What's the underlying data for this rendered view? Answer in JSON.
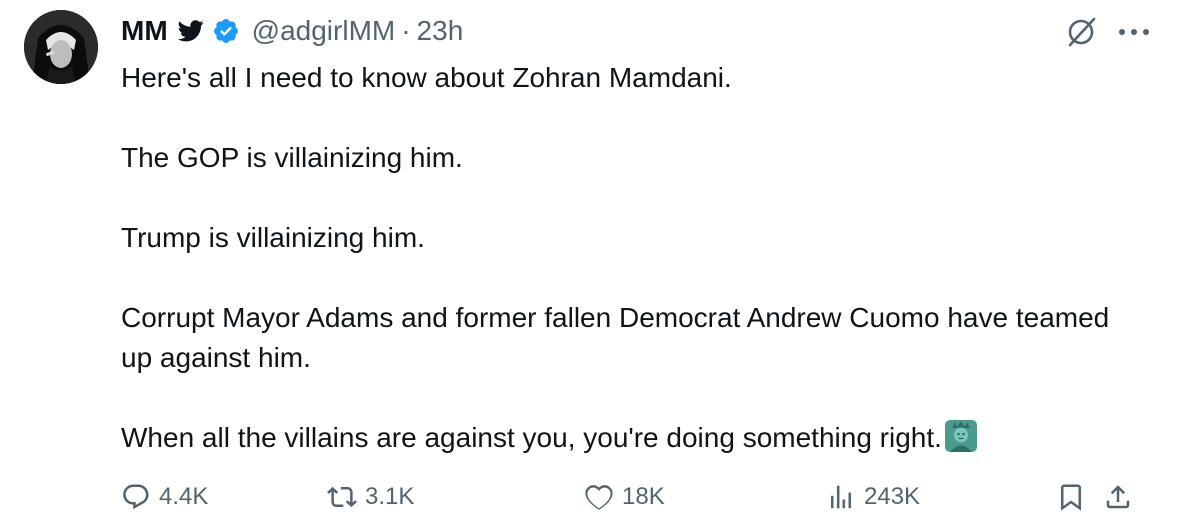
{
  "author": {
    "display_name": "MM",
    "handle": "@adgirlMM",
    "separator": "·",
    "time": "23h"
  },
  "tweet": {
    "paragraphs": [
      "Here's all I need to know about Zohran Mamdani.",
      "The GOP is villainizing him.",
      "Trump is villainizing him.",
      "Corrupt Mayor Adams and former fallen Democrat Andrew Cuomo have teamed up against him.",
      "When all the villains are against you, you're doing something right."
    ],
    "emoji": "statue-of-liberty"
  },
  "metrics": {
    "replies": "4.4K",
    "retweets": "3.1K",
    "likes": "18K",
    "views": "243K"
  },
  "icons": {
    "bird": "bird-icon",
    "verified": "verified-badge-icon",
    "grok": "grok-icon",
    "more": "more-icon",
    "reply": "reply-icon",
    "retweet": "retweet-icon",
    "like": "heart-icon",
    "views": "views-icon",
    "bookmark": "bookmark-icon",
    "share": "share-icon"
  },
  "colors": {
    "text": "#0f1419",
    "secondary": "#536471",
    "verified": "#1d9bf0"
  }
}
